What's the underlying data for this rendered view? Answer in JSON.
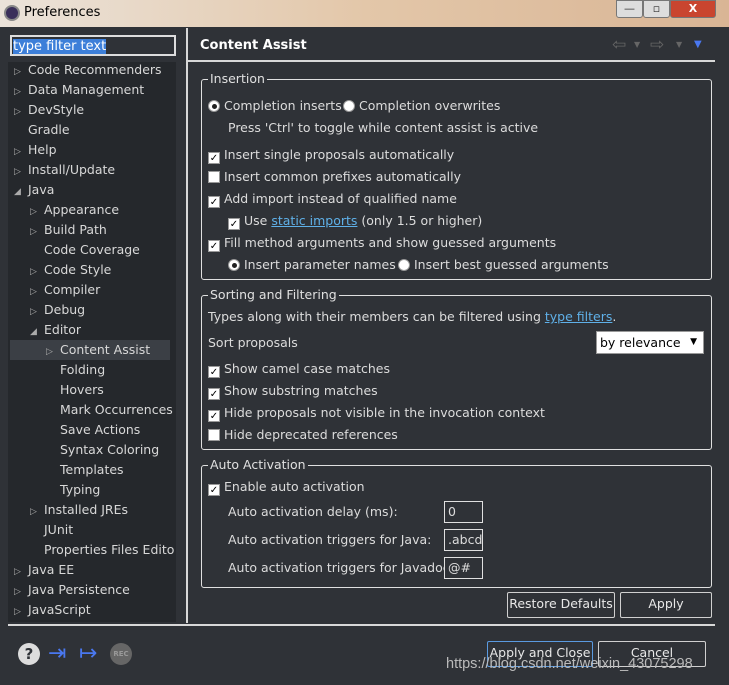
{
  "window": {
    "title": "Preferences",
    "minimize": "—",
    "restore": "▫",
    "close": "X"
  },
  "filter": {
    "value": "type filter text"
  },
  "tree": [
    {
      "label": "Code Recommenders",
      "level": 0,
      "arrow": "collapsed"
    },
    {
      "label": "Data Management",
      "level": 0,
      "arrow": "collapsed"
    },
    {
      "label": "DevStyle",
      "level": 0,
      "arrow": "collapsed"
    },
    {
      "label": "Gradle",
      "level": 0,
      "arrow": "none"
    },
    {
      "label": "Help",
      "level": 0,
      "arrow": "collapsed"
    },
    {
      "label": "Install/Update",
      "level": 0,
      "arrow": "collapsed"
    },
    {
      "label": "Java",
      "level": 0,
      "arrow": "expanded"
    },
    {
      "label": "Appearance",
      "level": 1,
      "arrow": "collapsed"
    },
    {
      "label": "Build Path",
      "level": 1,
      "arrow": "collapsed"
    },
    {
      "label": "Code Coverage",
      "level": 1,
      "arrow": "none"
    },
    {
      "label": "Code Style",
      "level": 1,
      "arrow": "collapsed"
    },
    {
      "label": "Compiler",
      "level": 1,
      "arrow": "collapsed"
    },
    {
      "label": "Debug",
      "level": 1,
      "arrow": "collapsed"
    },
    {
      "label": "Editor",
      "level": 1,
      "arrow": "expanded"
    },
    {
      "label": "Content Assist",
      "level": 2,
      "arrow": "collapsed",
      "selected": true
    },
    {
      "label": "Folding",
      "level": 2,
      "arrow": "none"
    },
    {
      "label": "Hovers",
      "level": 2,
      "arrow": "none"
    },
    {
      "label": "Mark Occurrences",
      "level": 2,
      "arrow": "none"
    },
    {
      "label": "Save Actions",
      "level": 2,
      "arrow": "none"
    },
    {
      "label": "Syntax Coloring",
      "level": 2,
      "arrow": "none"
    },
    {
      "label": "Templates",
      "level": 2,
      "arrow": "none"
    },
    {
      "label": "Typing",
      "level": 2,
      "arrow": "none"
    },
    {
      "label": "Installed JREs",
      "level": 1,
      "arrow": "collapsed"
    },
    {
      "label": "JUnit",
      "level": 1,
      "arrow": "none"
    },
    {
      "label": "Properties Files Edito",
      "level": 1,
      "arrow": "none"
    },
    {
      "label": "Java EE",
      "level": 0,
      "arrow": "collapsed"
    },
    {
      "label": "Java Persistence",
      "level": 0,
      "arrow": "collapsed"
    },
    {
      "label": "JavaScript",
      "level": 0,
      "arrow": "collapsed"
    }
  ],
  "page": {
    "title": "Content Assist"
  },
  "insertion": {
    "label": "Insertion",
    "completion_inserts": "Completion inserts",
    "completion_overwrites": "Completion overwrites",
    "hint": "Press 'Ctrl' to toggle while content assist is active",
    "single": "Insert single proposals automatically",
    "prefixes": "Insert common prefixes automatically",
    "add_import": "Add import instead of qualified name",
    "use": "Use",
    "static_imports": "static imports",
    "only": "(only 1.5 or higher)",
    "fill": "Fill method arguments and show guessed arguments",
    "param_names": "Insert parameter names",
    "best_guessed": "Insert best guessed arguments"
  },
  "sorting": {
    "label": "Sorting and Filtering",
    "desc": "Types along with their members can be filtered using",
    "type_filters": "type filters",
    "period": ".",
    "sort_label": "Sort proposals",
    "sort_value": "by relevance",
    "camel": "Show camel case matches",
    "substring": "Show substring matches",
    "hide_invisible": "Hide proposals not visible in the invocation context",
    "hide_deprecated": "Hide deprecated references"
  },
  "auto": {
    "label": "Auto Activation",
    "enable": "Enable auto activation",
    "delay_label": "Auto activation delay (ms):",
    "delay_value": "0",
    "java_label": "Auto activation triggers for Java:",
    "java_value": ".abcd",
    "javadoc_label": "Auto activation triggers for Javadoc:",
    "javadoc_value": "@#"
  },
  "buttons": {
    "restore": "Restore Defaults",
    "apply": "Apply",
    "apply_close": "Apply and Close",
    "cancel": "Cancel"
  },
  "watermark": "https://blog.csdn.net/weixin_43075298",
  "colors": {
    "background": "#2f3237",
    "link": "#5fb0e8",
    "selection": "#3d7fd9",
    "icon_blue": "#4a78f0"
  }
}
